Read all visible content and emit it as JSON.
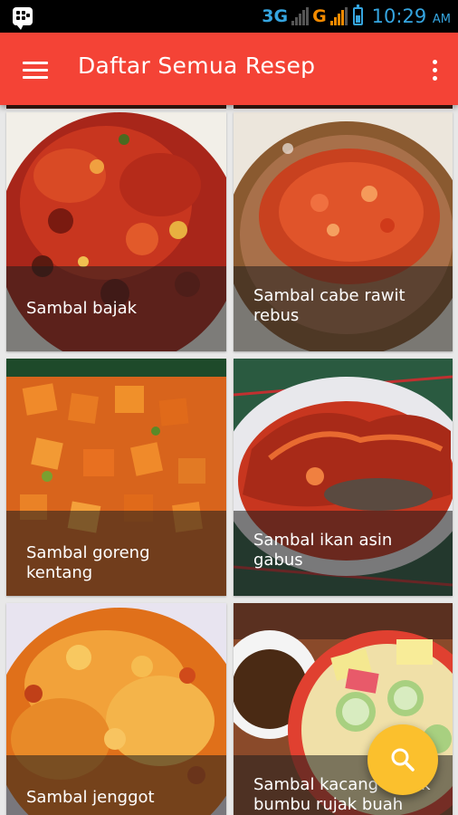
{
  "status_bar": {
    "network_primary": "3G",
    "network_secondary": "G",
    "time": "10:29",
    "ampm": "AM",
    "icons": [
      "bbm-notification-icon",
      "signal-icon",
      "signal-icon",
      "battery-icon"
    ]
  },
  "app_bar": {
    "title": "Daftar Semua Resep",
    "menu_icon": "hamburger-menu-icon",
    "overflow_icon": "more-vert-icon",
    "color": "#f44336"
  },
  "recipes": [
    {
      "name": "Sambal bajak"
    },
    {
      "name": "Sambal cabe rawit rebus"
    },
    {
      "name": "Sambal goreng kentang"
    },
    {
      "name": "Sambal ikan asin gabus"
    },
    {
      "name": "Sambal jenggot"
    },
    {
      "name": "Sambal kacang untuk bumbu rujak buah"
    }
  ],
  "fab": {
    "icon": "search-icon",
    "color": "#fbc02d"
  }
}
